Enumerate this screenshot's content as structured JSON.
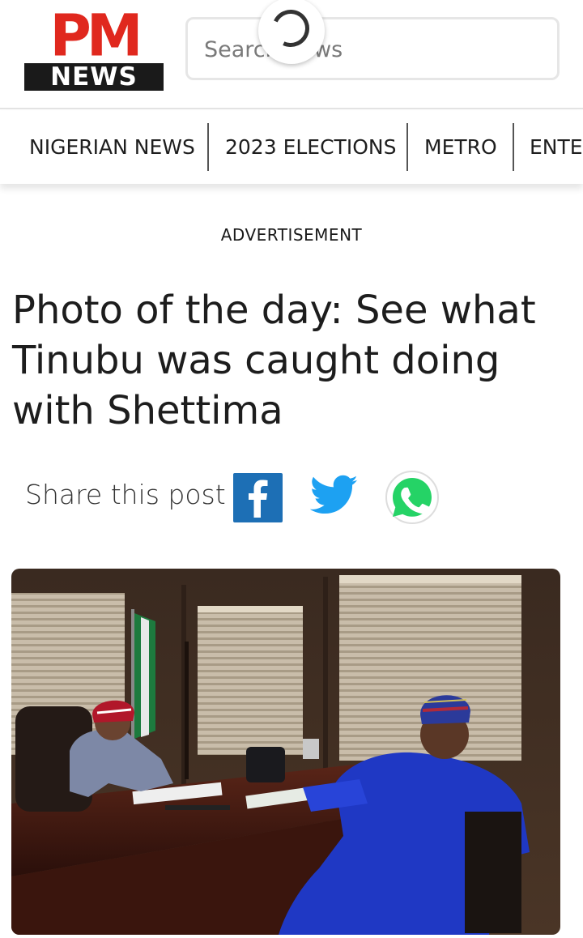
{
  "header": {
    "logo_top": "PM",
    "logo_bottom": "NEWS",
    "search_placeholder": "Search news"
  },
  "nav": {
    "items": [
      "NIGERIAN NEWS",
      "2023 ELECTIONS",
      "METRO",
      "ENTERTAINMENT"
    ]
  },
  "ad_label": "ADVERTISEMENT",
  "article": {
    "title": "Photo of the day: See what Tinubu was caught doing with Shettima"
  },
  "share": {
    "label": "Share this post",
    "icons": [
      "facebook-icon",
      "twitter-icon",
      "whatsapp-icon"
    ]
  },
  "colors": {
    "brand_red": "#e0281e",
    "facebook": "#1d6fb5",
    "twitter": "#1da1f2",
    "whatsapp": "#25d366"
  }
}
